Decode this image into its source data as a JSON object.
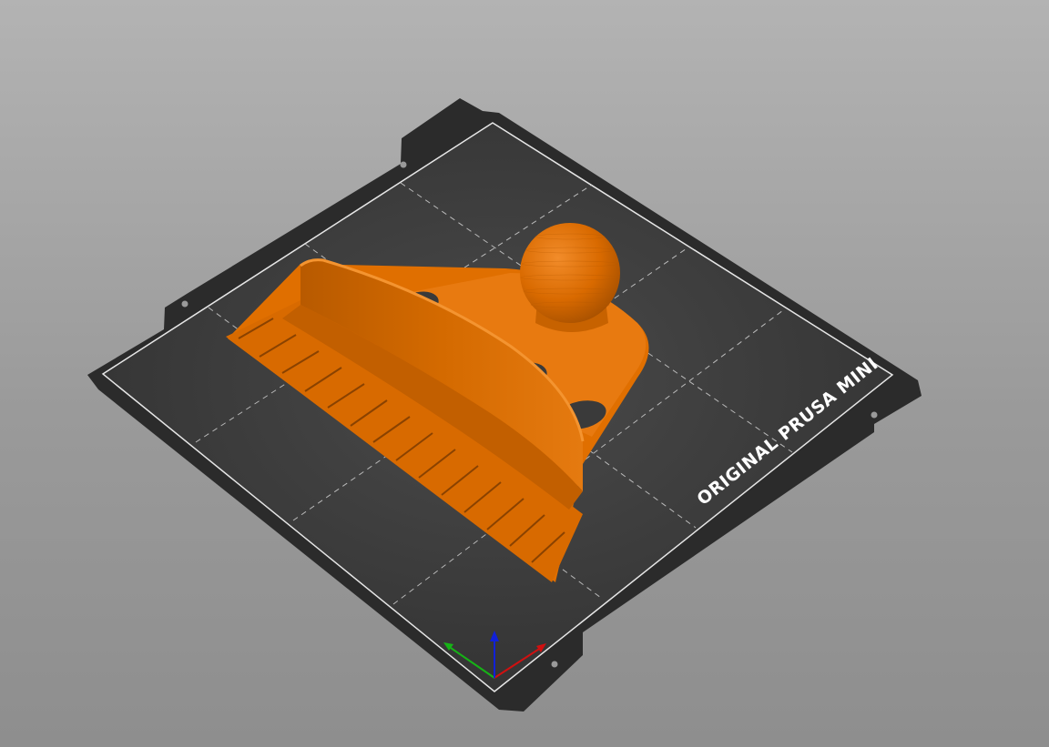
{
  "app": {
    "view": "3D build plate viewport"
  },
  "bed": {
    "label": "ORIGINAL PRUSA MINI",
    "sheet_color": "#2b2b2b",
    "surface_color": "#3a3a3a",
    "grid_color": "#cfcfcf",
    "border_color": "#e6e6e6"
  },
  "model": {
    "color": "#e57200",
    "shadow_color": "#b85a00",
    "highlight_color": "#f08a22"
  },
  "axes": {
    "x_color": "#d01010",
    "y_color": "#16b316",
    "z_color": "#1020d8"
  },
  "background": {
    "top": "#b3b3b3",
    "bottom": "#8e8e8e"
  }
}
